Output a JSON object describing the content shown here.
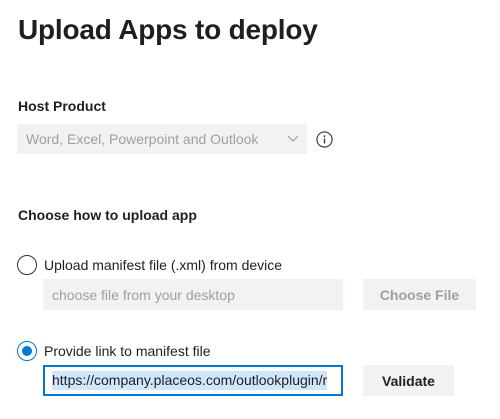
{
  "page": {
    "title": "Upload Apps to deploy"
  },
  "host_product": {
    "label": "Host Product",
    "selected_value": "Word, Excel, Powerpoint and Outlook",
    "dropdown_icon": "chevron-down-icon",
    "info_icon": "info-icon",
    "disabled": true
  },
  "upload_method": {
    "label": "Choose how to upload app",
    "options": [
      {
        "label": "Upload manifest file (.xml) from device",
        "selected": false,
        "input_placeholder": "choose file from your desktop",
        "button_label": "Choose File"
      },
      {
        "label": "Provide link to manifest file",
        "selected": true,
        "input_value": "https://company.placeos.com/outlookplugin/r",
        "button_label": "Validate"
      }
    ]
  },
  "colors": {
    "accent": "#0078d4",
    "disabled_bg": "#f3f2f1",
    "disabled_text": "#a19f9d",
    "text": "#201f1e",
    "selection_bg": "#cfe6fb"
  }
}
